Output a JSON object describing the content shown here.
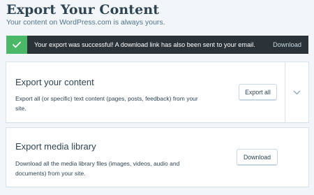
{
  "header": {
    "title": "Export Your Content",
    "subtitle": "Your content on WordPress.com is always yours."
  },
  "notice": {
    "status": "success",
    "icon": "checkmark-icon",
    "message": "Your export was successful! A download link has also been sent to your email.",
    "action_label": "Download",
    "colors": {
      "background": "#2c3338",
      "status": "#4ab866"
    }
  },
  "export_content": {
    "heading": "Export your content",
    "description": "Export all (or specific) text content (pages, posts, feedback) from your site.",
    "button_label": "Export all",
    "expand_icon": "chevron-down-icon"
  },
  "export_media": {
    "heading": "Export media library",
    "description": "Download all the media library files (images, videos, audio and documents) from your site.",
    "button_label": "Download"
  }
}
